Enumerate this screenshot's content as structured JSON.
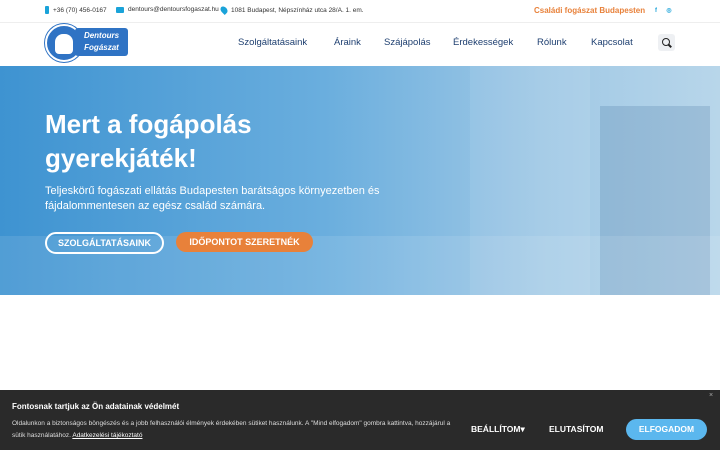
{
  "topbar": {
    "phone": "+36 (70) 456-0167",
    "email": "dentours@dentoursfogaszat.hu",
    "address": "1081 Budapest, Népszínház utca 28/A. 1. em.",
    "tagline": "Családi fogászat Budapesten",
    "social": [
      "facebook-icon",
      "instagram-icon"
    ]
  },
  "logo": {
    "line1": "Dentours",
    "line2": "Fogászat"
  },
  "nav": [
    "Szolgáltatásaink",
    "Áraink",
    "Szájápolás",
    "Érdekességek",
    "Rólunk",
    "Kapcsolat"
  ],
  "hero": {
    "title": "Mert a fogápolás gyerekjáték!",
    "lead": "Teljeskörű fogászati ellátás Budapesten barátságos környezetben és fájdalommentesen az egész család számára.",
    "btn_services": "SZOLGÁLTATÁSAINK",
    "btn_appointment": "IDŐPONTOT SZERETNÉK"
  },
  "cookie": {
    "title": "Fontosnak tartjuk az Ön adatainak védelmét",
    "text": "Oldalunkon a biztonságos böngészés és a jobb felhasználói élmények érdekében sütiket használunk. A \"Mind elfogadom\" gombra kattintva, hozzájárul a sütik használatához.",
    "link": "Adatkezelési tájékoztató",
    "btn_settings": "BEÁLLÍTOM",
    "btn_reject": "ELUTASÍTOM",
    "btn_accept": "ELFOGADOM",
    "close": "×"
  },
  "colors": {
    "accent": "#1aa3d9",
    "orange": "#e8813a",
    "navy": "#1e3f70",
    "accept": "#5bb7ee"
  }
}
